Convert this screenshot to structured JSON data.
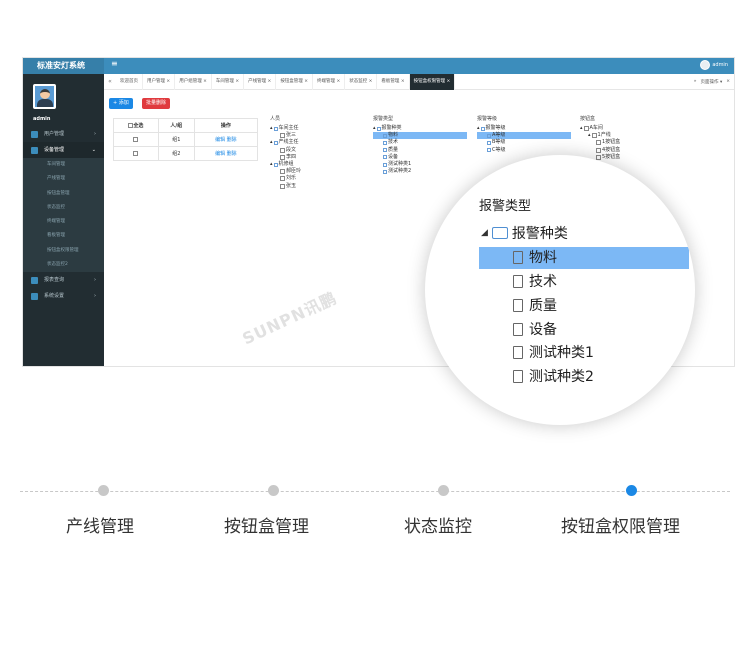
{
  "app": {
    "title": "标准安灯系统",
    "user": "admin",
    "menu_toggle": "≡"
  },
  "sidebar": {
    "username": "admin",
    "items": [
      {
        "label": "用户管理",
        "arrow": "›"
      },
      {
        "label": "设备管理",
        "arrow": "⌄"
      }
    ],
    "subitems": [
      "车间管理",
      "产线管理",
      "按钮盒管理",
      "状态监控",
      "终端管理",
      "看板管理",
      "按钮盒权限管理",
      "状态监控2"
    ],
    "bottom_items": [
      {
        "label": "报表查询",
        "arrow": "›"
      },
      {
        "label": "系统设置",
        "arrow": "›"
      }
    ]
  },
  "tabs": {
    "nav_prev": "«",
    "nav_next": "»",
    "items": [
      "欢迎首页",
      "用户管理 ×",
      "用户组管理 ×",
      "车间管理 ×",
      "产线管理 ×",
      "按钮盒管理 ×",
      "终端管理 ×",
      "状态监控 ×",
      "看板管理 ×",
      "按钮盒权限管理 ×"
    ],
    "page_ops": "页面操作 ▾",
    "close": "×"
  },
  "toolbar": {
    "add_label": "+ 添加",
    "batch_delete_label": "批量删除"
  },
  "table": {
    "headers": [
      "全选",
      "人/组",
      "操作"
    ],
    "rows": [
      {
        "name": "组1",
        "ops": "编辑 删除"
      },
      {
        "name": "组2",
        "ops": "编辑 删除"
      }
    ]
  },
  "personnel_tree": {
    "title": "人员",
    "nodes": [
      "车间主任",
      "张三",
      "产线主任",
      "段文",
      "李四",
      "机修组",
      "郝臣玲",
      "刘乐",
      "张玉"
    ]
  },
  "alarm_type_tree": {
    "title": "报警类型",
    "root": "报警种类",
    "items": [
      "物料",
      "技术",
      "质量",
      "设备",
      "测试种类1",
      "测试种类2"
    ],
    "selected": "物料"
  },
  "alarm_level_tree": {
    "title": "报警等级",
    "root": "报警等级",
    "items": [
      "A等级",
      "B等级",
      "C等级"
    ],
    "selected": "A等级"
  },
  "button_box_tree": {
    "title": "按钮盒",
    "nodes": [
      "A车间",
      "1产线",
      "1按钮盒",
      "4按钮盒",
      "5按钮盒"
    ]
  },
  "magnifier": {
    "title": "报警类型",
    "root": "报警种类",
    "items": [
      "物料",
      "技术",
      "质量",
      "设备",
      "测试种类1",
      "测试种类2"
    ],
    "selected": "物料"
  },
  "watermark": "SUNPN讯鹏",
  "steps": {
    "items": [
      "产线管理",
      "按钮盒管理",
      "状态监控",
      "按钮盒权限管理"
    ],
    "active_index": 3,
    "active_color": "#1b88e5",
    "inactive_color": "#c8c8c8"
  }
}
